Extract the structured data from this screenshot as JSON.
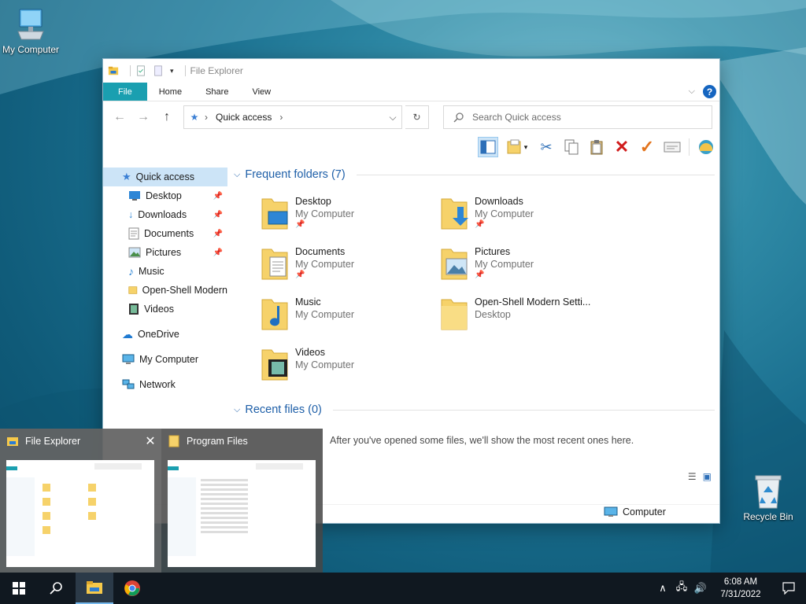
{
  "desktop": {
    "my_computer_label": "My Computer",
    "recycle_bin_label": "Recycle Bin"
  },
  "window": {
    "title": "File Explorer",
    "tabs": [
      "File",
      "Home",
      "Share",
      "View"
    ],
    "address": {
      "crumb": "Quick access"
    },
    "search_placeholder": "Search Quick access",
    "toolbar_icons": [
      "preview-pane-icon",
      "view-options-icon",
      "cut-icon",
      "copy-icon",
      "paste-icon",
      "delete-icon",
      "rename-icon",
      "properties-icon",
      "openshell-icon"
    ],
    "nav": {
      "quick_access": "Quick access",
      "items": [
        {
          "label": "Desktop",
          "pinned": true
        },
        {
          "label": "Downloads",
          "pinned": true
        },
        {
          "label": "Documents",
          "pinned": true
        },
        {
          "label": "Pictures",
          "pinned": true
        },
        {
          "label": "Music",
          "pinned": false
        },
        {
          "label": "Open-Shell Modern",
          "pinned": false
        },
        {
          "label": "Videos",
          "pinned": false
        }
      ],
      "onedrive": "OneDrive",
      "my_computer": "My Computer",
      "network": "Network"
    },
    "frequent": {
      "header": "Frequent folders (7)",
      "folders": [
        {
          "name": "Desktop",
          "location": "My Computer",
          "pinned": true
        },
        {
          "name": "Downloads",
          "location": "My Computer",
          "pinned": true
        },
        {
          "name": "Documents",
          "location": "My Computer",
          "pinned": true
        },
        {
          "name": "Pictures",
          "location": "My Computer",
          "pinned": true
        },
        {
          "name": "Music",
          "location": "My Computer",
          "pinned": false
        },
        {
          "name": "Open-Shell Modern Setti...",
          "location": "Desktop",
          "pinned": false
        },
        {
          "name": "Videos",
          "location": "My Computer",
          "pinned": false
        }
      ]
    },
    "recent": {
      "header": "Recent files (0)",
      "empty_message": "After you've opened some files, we'll show the most recent ones here."
    },
    "status": {
      "location": "Computer"
    }
  },
  "previews": [
    {
      "title": "File Explorer",
      "hovered": true
    },
    {
      "title": "Program Files",
      "hovered": false
    }
  ],
  "taskbar": {
    "time": "6:08 AM",
    "date": "7/31/2022"
  },
  "colors": {
    "accent": "#1a9fb0",
    "link_blue": "#1e5fa8",
    "selection": "#cce4f7",
    "taskbar": "#101820"
  }
}
